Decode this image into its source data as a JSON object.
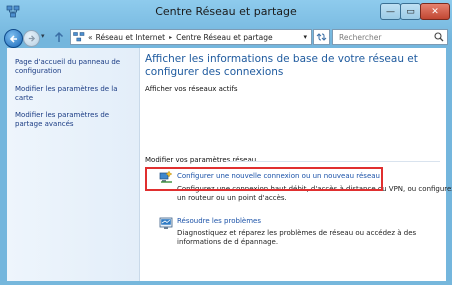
{
  "window": {
    "title": "Centre Réseau et partage",
    "close_glyph": "✕",
    "min_glyph": "—",
    "max_glyph": "▭"
  },
  "address_bar": {
    "prefix": "«",
    "crumbs": [
      "Réseau et Internet",
      "Centre Réseau et partage"
    ],
    "separator": "▸",
    "search_placeholder": "Rechercher"
  },
  "sidebar": {
    "items": [
      {
        "label": "Page d'accueil du panneau de configuration"
      },
      {
        "label": "Modifier les paramètres de la carte"
      },
      {
        "label": "Modifier les paramètres de partage avancés"
      }
    ]
  },
  "main": {
    "title": "Afficher les informations de base de votre réseau et configurer des connexions",
    "active_networks_label": "Afficher vos réseaux actifs",
    "settings_label": "Modifier vos paramètres réseau",
    "tasks": [
      {
        "link": "Configurer une nouvelle connexion ou un nouveau réseau",
        "desc": "Configurez une connexion haut débit, d'accès à distance ou VPN, ou configurez un routeur ou un point d'accès.",
        "icon": "network-setup-icon"
      },
      {
        "link": "Résoudre les problèmes",
        "desc": "Diagnostiquez et réparez les problèmes de réseau ou accédez à des informations de d épannage.",
        "icon": "troubleshoot-icon"
      }
    ]
  },
  "colors": {
    "frame": "#76b7dc",
    "link": "#1b52a8",
    "title": "#1e5a9e",
    "highlight": "#e02f2f",
    "close_button": "#c14733"
  }
}
